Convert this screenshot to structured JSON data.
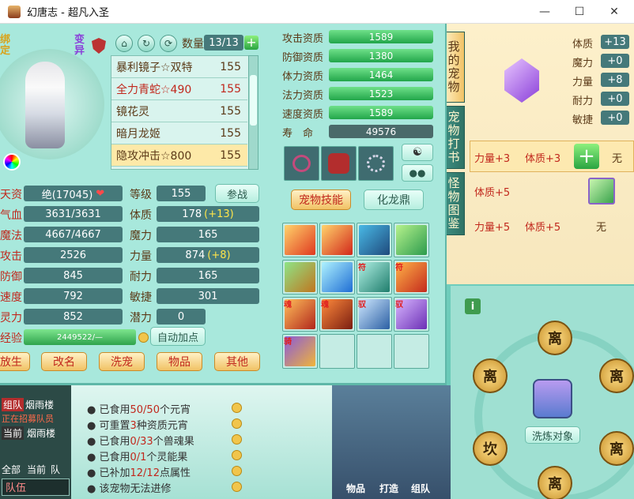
{
  "window": {
    "title": "幻唐志 - 超凡入圣",
    "min": "—",
    "max": "☐",
    "close": "✕"
  },
  "header": {
    "bind_label": "绑定",
    "mutate_label": "变异",
    "count_label": "数量",
    "count_value": "13/13",
    "add": "+"
  },
  "pets": [
    {
      "name": "暴利镜子☆双特",
      "level": "155"
    },
    {
      "name": "全力青蛇☆490",
      "level": "155"
    },
    {
      "name": "镜花灵",
      "level": "155"
    },
    {
      "name": "暗月龙姬",
      "level": "155"
    },
    {
      "name": "隐攻冲击☆800",
      "level": "155"
    }
  ],
  "stats": {
    "aptitude_label": "天资",
    "aptitude_value": "绝(17045)",
    "hp_label": "气血",
    "hp_value": "3631/3631",
    "mp_label": "魔法",
    "mp_value": "4667/4667",
    "atk_label": "攻击",
    "atk_value": "2526",
    "def_label": "防御",
    "def_value": "845",
    "spd_label": "速度",
    "spd_value": "792",
    "spi_label": "灵力",
    "spi_value": "852",
    "exp_label": "经验",
    "exp_value": "2449522/—",
    "grade_label": "等级",
    "grade_value": "155",
    "con_label": "体质",
    "con_value": "178",
    "con_bonus": "(+13)",
    "mag_label": "魔力",
    "mag_value": "165",
    "str_label": "力量",
    "str_value": "874",
    "str_bonus": "(+8)",
    "end_label": "耐力",
    "end_value": "165",
    "agi_label": "敏捷",
    "agi_value": "301",
    "pot_label": "潜力",
    "pot_value": "0",
    "battle_btn": "参战",
    "autopoint_btn": "自动加点"
  },
  "bottom_buttons": [
    "放生",
    "改名",
    "洗宠",
    "物品",
    "其他"
  ],
  "aptitudes": [
    {
      "label": "攻击资质",
      "value": "1589"
    },
    {
      "label": "防御资质",
      "value": "1380"
    },
    {
      "label": "体力资质",
      "value": "1464"
    },
    {
      "label": "法力资质",
      "value": "1523"
    },
    {
      "label": "速度资质",
      "value": "1589"
    },
    {
      "label": "寿　命",
      "value": "49576"
    }
  ],
  "skill_tabs": {
    "skills": "宠物技能",
    "dragon": "化龙鼎"
  },
  "skill_tags": [
    "",
    "",
    "",
    "",
    "",
    "",
    "符",
    "符",
    "魂",
    "魂",
    "驭",
    "驭",
    "骑"
  ],
  "side_tabs": [
    "我的宠物",
    "宠物打书",
    "怪物图鉴"
  ],
  "right": {
    "stats": [
      {
        "label": "体质",
        "value": "+13"
      },
      {
        "label": "魔力",
        "value": "+0"
      },
      {
        "label": "力量",
        "value": "+8"
      },
      {
        "label": "耐力",
        "value": "+0"
      },
      {
        "label": "敏捷",
        "value": "+0"
      }
    ],
    "rows": [
      {
        "a": "力量+3",
        "b": "体质+3",
        "c": "无"
      },
      {
        "a": "体质+5",
        "b": "",
        "c": ""
      },
      {
        "a": "力量+5",
        "b": "体质+5",
        "c": "无"
      }
    ]
  },
  "info_lines": [
    {
      "pre": "已食用",
      "hl": "50/50",
      "post": "个元宵"
    },
    {
      "pre": "可重置",
      "hl": "3",
      "post": "种资质元宵"
    },
    {
      "pre": "已食用",
      "hl": "0/33",
      "post": "个兽魂果"
    },
    {
      "pre": "已食用",
      "hl": "0/1",
      "post": "个灵能果"
    },
    {
      "pre": "已补加",
      "hl": "12/12",
      "post": "点属性"
    },
    {
      "pre": "该宠物无法进修",
      "hl": "",
      "post": ""
    }
  ],
  "chat": {
    "team": "组队",
    "sys": "烟雨楼",
    "recruit": "正在招募队员",
    "current": "当前",
    "all": "全部",
    "cur2": "当前",
    "team2": "队",
    "teamtab": "队伍"
  },
  "wheel": {
    "seal": "离",
    "seal2": "坎",
    "target_btn": "洗炼对象",
    "info_icon": "i"
  },
  "taskbar": [
    "物品",
    "打造",
    "组队"
  ]
}
